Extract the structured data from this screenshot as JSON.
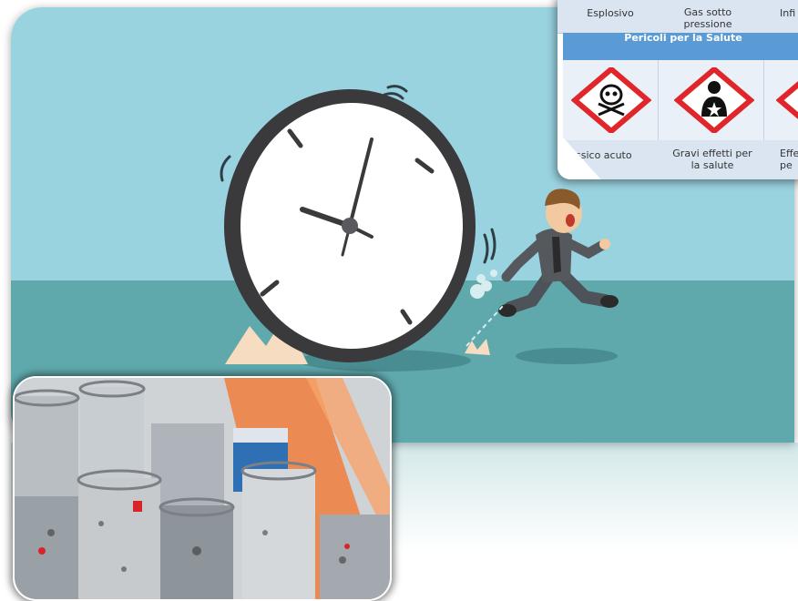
{
  "ghs_table": {
    "top_labels": [
      "Esplosivo",
      "Gas sotto\npressione",
      "Infi"
    ],
    "section_title": "Pericoli per la Salute",
    "icons": [
      "skull-crossbones-icon",
      "health-hazard-icon",
      "exclamation-icon"
    ],
    "bottom_labels": [
      "ssico acuto",
      "Gravi effetti per\nla salute",
      "Effe\npe"
    ]
  },
  "colors": {
    "sky": "#9ad3e0",
    "floor": "#5fa9ad",
    "clock_rim": "#3a3a3c",
    "ghs_red": "#e0262b",
    "section_blue": "#5b9bd5"
  }
}
